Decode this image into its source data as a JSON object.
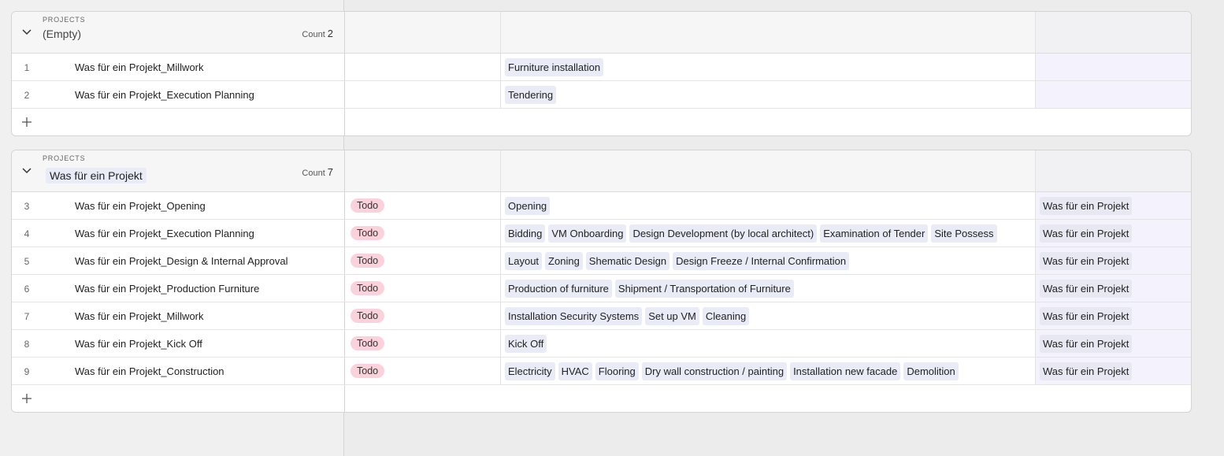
{
  "groups": [
    {
      "field_name": "PROJECTS",
      "value": "(Empty)",
      "count_label": "Count",
      "count": "2",
      "rows": [
        {
          "num": "1",
          "name": "Was für ein Projekt_Millwork",
          "status": "",
          "tags": [
            "Furniture installation"
          ],
          "lookup": ""
        },
        {
          "num": "2",
          "name": "Was für ein Projekt_Execution Planning",
          "status": "",
          "tags": [
            "Tendering"
          ],
          "lookup": ""
        }
      ]
    },
    {
      "field_name": "PROJECTS",
      "value": "Was für ein Projekt",
      "count_label": "Count",
      "count": "7",
      "rows": [
        {
          "num": "3",
          "name": "Was für ein Projekt_Opening",
          "status": "Todo",
          "tags": [
            "Opening"
          ],
          "lookup": "Was für ein Projekt"
        },
        {
          "num": "4",
          "name": "Was für ein Projekt_Execution Planning",
          "status": "Todo",
          "tags": [
            "Bidding",
            "VM Onboarding",
            "Design Development (by local architect)",
            "Examination of Tender",
            "Site Possess"
          ],
          "lookup": "Was für ein Projekt"
        },
        {
          "num": "5",
          "name": "Was für ein Projekt_Design & Internal Approval",
          "status": "Todo",
          "tags": [
            "Layout",
            "Zoning",
            "Shematic Design",
            "Design Freeze / Internal Confirmation"
          ],
          "lookup": "Was für ein Projekt"
        },
        {
          "num": "6",
          "name": "Was für ein Projekt_Production Furniture",
          "status": "Todo",
          "tags": [
            "Production of furniture",
            "Shipment / Transportation of Furniture"
          ],
          "lookup": "Was für ein Projekt"
        },
        {
          "num": "7",
          "name": "Was für ein Projekt_Millwork",
          "status": "Todo",
          "tags": [
            "Installation Security Systems",
            "Set up VM",
            "Cleaning"
          ],
          "lookup": "Was für ein Projekt"
        },
        {
          "num": "8",
          "name": "Was für ein Projekt_Kick Off",
          "status": "Todo",
          "tags": [
            "Kick Off"
          ],
          "lookup": "Was für ein Projekt"
        },
        {
          "num": "9",
          "name": "Was für ein Projekt_Construction",
          "status": "Todo",
          "tags": [
            "Electricity",
            "HVAC",
            "Flooring",
            "Dry wall construction / painting",
            "Installation new facade",
            "Demolition"
          ],
          "lookup": "Was für ein Projekt"
        }
      ]
    }
  ],
  "icons": {
    "collapse": "chevron-down-icon",
    "add": "plus-icon"
  },
  "colors": {
    "status_todo": "#fbd2dc",
    "tag_bg": "#e9ecf6",
    "lookup_bg": "#f4f2fc"
  }
}
